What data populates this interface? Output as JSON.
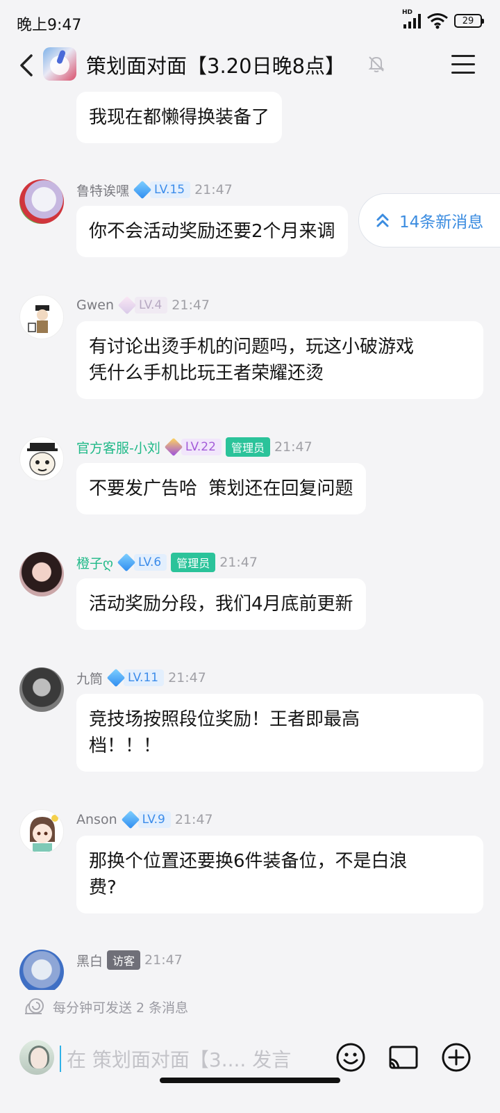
{
  "status_bar": {
    "time": "晚上9:47",
    "hd_label": "HD",
    "battery": "29"
  },
  "header": {
    "title": "策划面对面【3.20日晚8点】"
  },
  "new_messages": {
    "label": "14条新消息"
  },
  "messages": [
    {
      "text": "我现在都懒得换装备了"
    },
    {
      "name": "鲁特诶嘿",
      "level": "LV.15",
      "time": "21:47",
      "text": "你不会活动奖励还要2个月来调"
    },
    {
      "name": "Gwen",
      "level": "LV.4",
      "time": "21:47",
      "text_lines": [
        "有讨论出烫手机的问题吗，玩这小破游戏",
        "凭什么手机比玩王者荣耀还烫"
      ]
    },
    {
      "name": "官方客服-小刘",
      "level": "LV.22",
      "badge": "管理员",
      "time": "21:47",
      "text": "不要发广告哈  策划还在回复问题"
    },
    {
      "name": "橙子ღ",
      "level": "LV.6",
      "badge": "管理员",
      "time": "21:47",
      "text": "活动奖励分段，我们4月底前更新"
    },
    {
      "name": "九筒",
      "level": "LV.11",
      "time": "21:47",
      "text_lines": [
        "竞技场按照段位奖励！王者即最高",
        "档！！！"
      ]
    },
    {
      "name": "Anson",
      "level": "LV.9",
      "time": "21:47",
      "text_lines": [
        "那换个位置还要换6件装备位，不是白浪",
        "费?"
      ]
    },
    {
      "name": "黑白",
      "badge": "访客",
      "time": "21:47"
    }
  ],
  "footer": {
    "rate_limit": "每分钟可发送 2 条消息",
    "input_placeholder": "在 策划面对面【3.... 发言"
  },
  "colors": {
    "accent_blue": "#3b8ce0",
    "admin_green": "#2bc39a",
    "admin_name_green": "#20b988"
  }
}
